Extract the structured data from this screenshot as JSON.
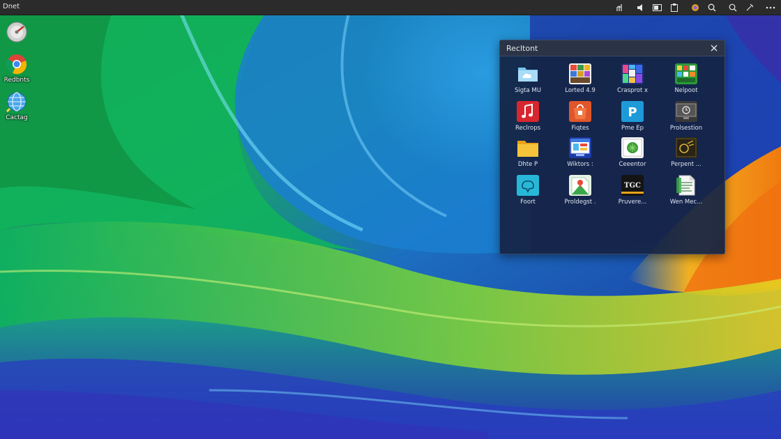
{
  "topbar": {
    "app_label": "Dnet",
    "tray_icons": [
      "network-icon",
      "volume-icon",
      "battery-icon",
      "clipboard-icon",
      "color-picker-icon",
      "search-icon",
      "zoom-icon",
      "tools-icon",
      "more-icon"
    ]
  },
  "desktop_icons": [
    {
      "label": "",
      "icon": "disk-icon"
    },
    {
      "label": "Redbnts",
      "icon": "browser-icon"
    },
    {
      "label": "Cactag",
      "icon": "globe-icon"
    }
  ],
  "launcher": {
    "title": "Recltont",
    "close_icon": "close-icon",
    "apps": [
      {
        "label": "Sigta MU",
        "icon": "cloud-folder-icon"
      },
      {
        "label": "Lorted 4.9",
        "icon": "media-grid-icon"
      },
      {
        "label": "Crasprot x",
        "icon": "tiles-icon"
      },
      {
        "label": "Nelpoot",
        "icon": "green-grid-icon"
      },
      {
        "label": "Reclrops",
        "icon": "music-icon"
      },
      {
        "label": "Fiqtes",
        "icon": "bag-icon"
      },
      {
        "label": "Pme Ep",
        "icon": "p-icon"
      },
      {
        "label": "Prolsestion",
        "icon": "monitor-icon"
      },
      {
        "label": "Dhte P",
        "icon": "folder-icon"
      },
      {
        "label": "Wiktors :",
        "icon": "desktop-window-icon"
      },
      {
        "label": "Ceeentor",
        "icon": "photo-icon"
      },
      {
        "label": "Perpent ...",
        "icon": "dark-tile-icon"
      },
      {
        "label": "Foort",
        "icon": "cyan-tile-icon"
      },
      {
        "label": "Proldegst .",
        "icon": "map-icon"
      },
      {
        "label": "Pruvere...",
        "icon": "tgc-icon"
      },
      {
        "label": "Wen Mec...",
        "icon": "document-icon"
      }
    ],
    "tile_text": {
      "tgc": "TGC",
      "p": "P"
    }
  }
}
